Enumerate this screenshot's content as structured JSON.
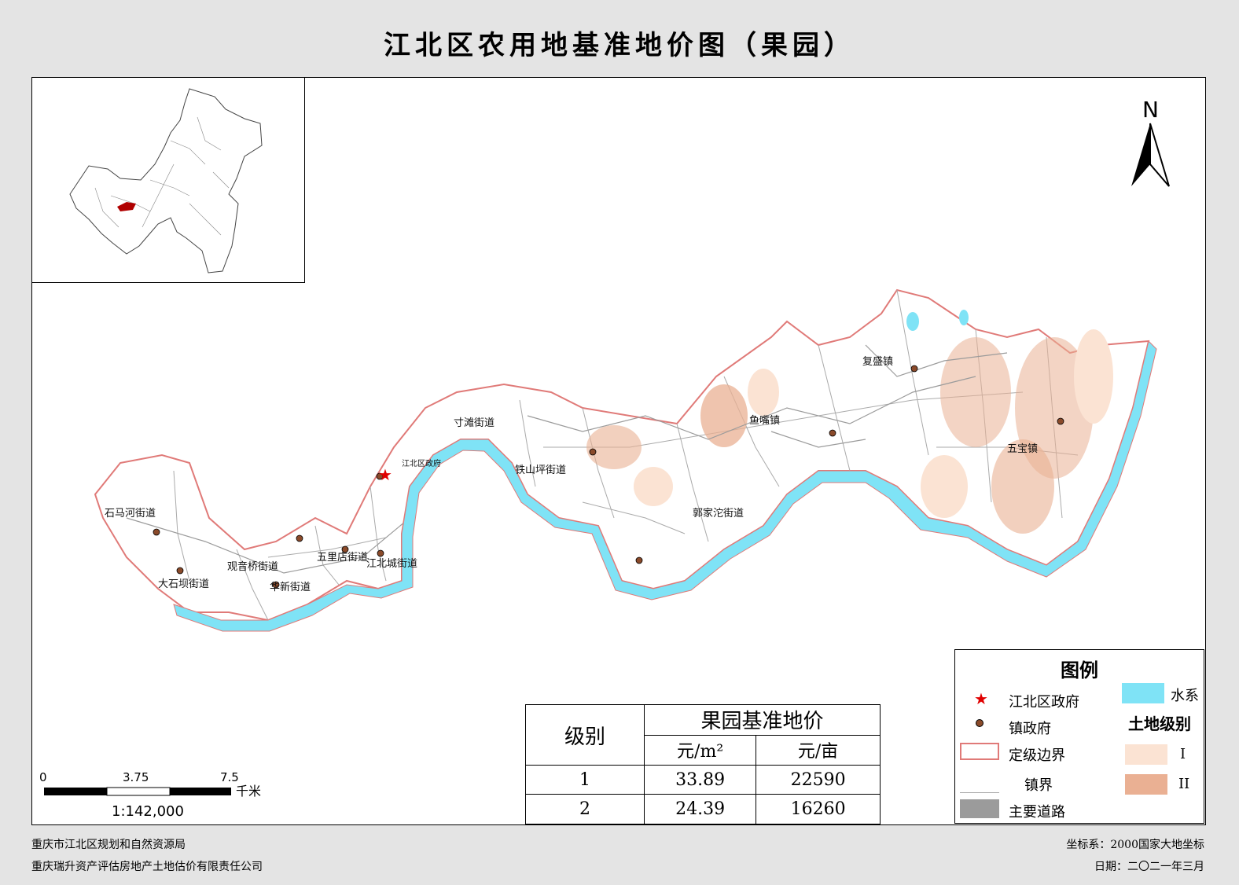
{
  "title": "江北区农用地基准地价图（果园）",
  "north_label": "N",
  "colors": {
    "river": "#7fe3f6",
    "boundary": "#e07a78",
    "grade1": "#fbe3d3",
    "grade2": "#eab093",
    "road": "#9b9b9b"
  },
  "map_labels": {
    "shima": "石马河街道",
    "dashiba": "大石坝街道",
    "guanyinqiao": "观音桥街道",
    "huaxin": "华新街道",
    "wulidian": "五里店街道",
    "jiangbeicheng": "江北城街道",
    "cuntan": "寸滩街道",
    "tieshanping": "铁山坪街道",
    "yuzui": "鱼嘴镇",
    "fusheng": "复盛镇",
    "wujia": "五宝镇",
    "guojiatuo": "郭家沱街道",
    "gov": "江北区政府"
  },
  "legend": {
    "title": "图例",
    "gov": "江北区政府",
    "town_gov": "镇政府",
    "boundary": "定级边界",
    "town_boundary": "镇界",
    "main_road": "主要道路",
    "water": "水系",
    "land_grade": "土地级别",
    "grade1": "I",
    "grade2": "II"
  },
  "price_table": {
    "col_grade": "级别",
    "header": "果园基准地价",
    "unit_m2": "元/m²",
    "unit_mu": "元/亩",
    "rows": [
      {
        "grade": "1",
        "m2": "33.89",
        "mu": "22590"
      },
      {
        "grade": "2",
        "m2": "24.39",
        "mu": "16260"
      }
    ]
  },
  "scale": {
    "t0": "0",
    "t1": "3.75",
    "t2": "7.5",
    "unit": "千米",
    "ratio": "1:142,000"
  },
  "footer": {
    "org1": "重庆市江北区规划和自然资源局",
    "org2": "重庆瑞升资产评估房地产土地估价有限责任公司",
    "crs": "坐标系：2000国家大地坐标",
    "date": "日期：二〇二一年三月"
  }
}
